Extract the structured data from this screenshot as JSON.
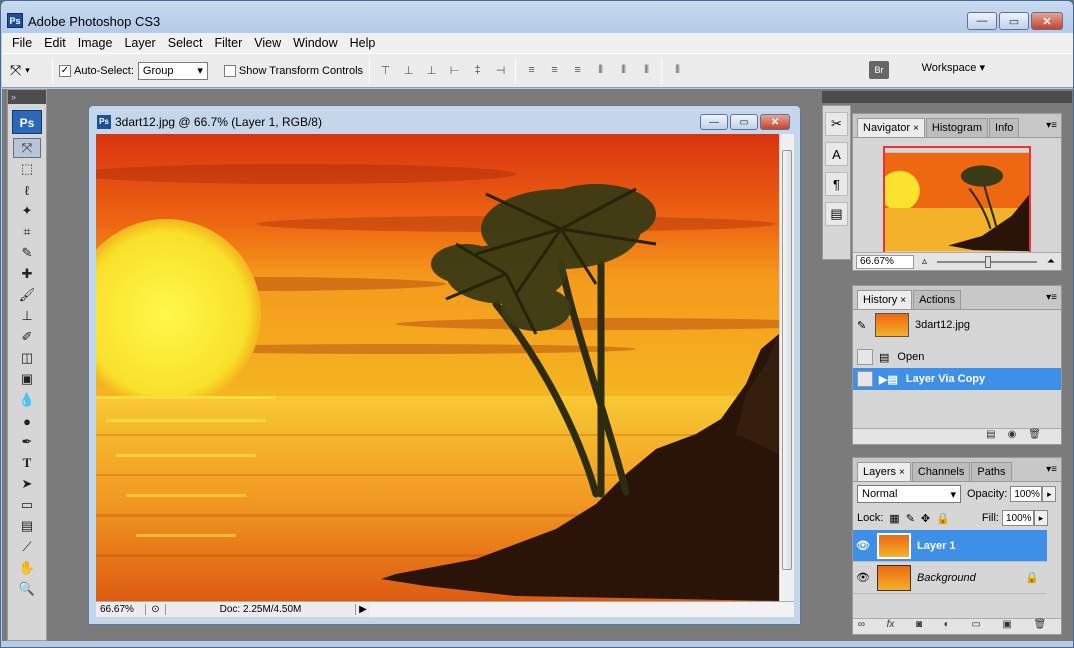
{
  "app": {
    "title": "Adobe Photoshop CS3",
    "logo": "Ps"
  },
  "window_buttons": {
    "minimize": "—",
    "maximize": "▭",
    "close": "✕"
  },
  "menu": [
    "File",
    "Edit",
    "Image",
    "Layer",
    "Select",
    "Filter",
    "View",
    "Window",
    "Help"
  ],
  "options": {
    "auto_select_label": "Auto-Select:",
    "auto_select_checked": true,
    "auto_select_value": "Group",
    "show_transform_label": "Show Transform Controls",
    "workspace_label": "Workspace ▾",
    "bridge_label": "Br"
  },
  "toolbox": {
    "badge": "Ps"
  },
  "document": {
    "title": "3dart12.jpg @ 66.7% (Layer 1, RGB/8)",
    "zoom": "66.67%",
    "doc_size": "Doc: 2.25M/4.50M"
  },
  "navigator": {
    "tabs": [
      "Navigator",
      "Histogram",
      "Info"
    ],
    "zoom": "66.67%"
  },
  "history": {
    "tabs": [
      "History",
      "Actions"
    ],
    "snapshot": "3dart12.jpg",
    "items": [
      {
        "label": "Open",
        "selected": false
      },
      {
        "label": "Layer Via Copy",
        "selected": true
      }
    ]
  },
  "layers": {
    "tabs": [
      "Layers",
      "Channels",
      "Paths"
    ],
    "blend_mode": "Normal",
    "opacity_label": "Opacity:",
    "opacity": "100%",
    "lock_label": "Lock:",
    "fill_label": "Fill:",
    "fill": "100%",
    "items": [
      {
        "name": "Layer 1",
        "selected": true
      },
      {
        "name": "Background",
        "selected": false,
        "locked": true
      }
    ]
  },
  "colors": {
    "selection": "#3d8fe8",
    "title_bar": "#c9daf0"
  }
}
